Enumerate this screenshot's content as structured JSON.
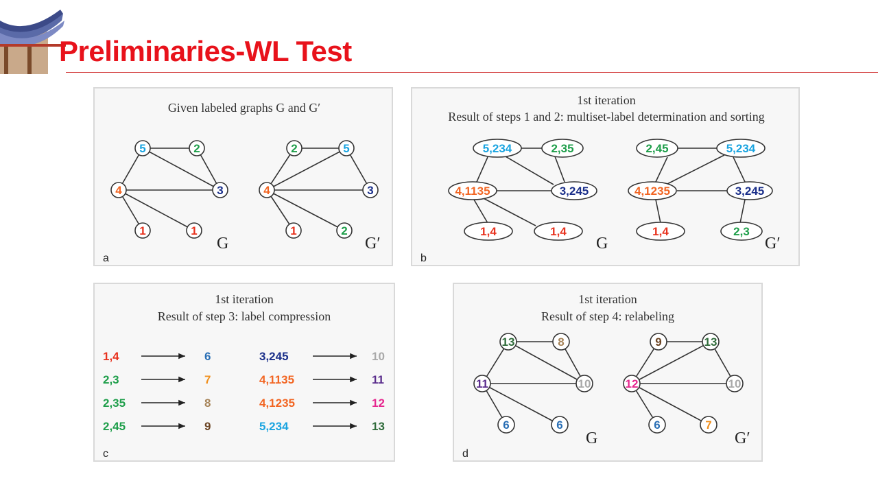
{
  "slide": {
    "title": "Preliminaries-WL Test"
  },
  "colors": {
    "title": "#e8121b",
    "red": "#e8321e",
    "orange": "#f26522",
    "green": "#1e9e4a",
    "cyan": "#1aa4e0",
    "navy": "#1a2f8a",
    "blue": "#2a6fb5",
    "brown": "#8b5a2b",
    "tan": "#a68358",
    "dkgreen": "#2f6b3a",
    "gray": "#a9a9a9",
    "purple": "#5a2d8c",
    "magenta": "#e6288f",
    "amber": "#f0901e"
  },
  "panel_a": {
    "letter": "a",
    "caption": "Given labeled graphs G and G′",
    "G": {
      "name": "G",
      "labels": [
        "5",
        "2",
        "4",
        "3",
        "1",
        "1"
      ]
    },
    "Gp": {
      "name": "G′",
      "labels": [
        "2",
        "5",
        "4",
        "3",
        "1",
        "2"
      ]
    }
  },
  "panel_b": {
    "letter": "b",
    "caption1": "1st iteration",
    "caption2": "Result of steps 1 and 2: multiset-label determination and sorting",
    "G": {
      "name": "G",
      "labels": [
        "5,234",
        "2,35",
        "4,1135",
        "3,245",
        "1,4",
        "1,4"
      ]
    },
    "Gp": {
      "name": "G′",
      "labels": [
        "2,45",
        "5,234",
        "4,1235",
        "3,245",
        "1,4",
        "2,3"
      ]
    }
  },
  "panel_c": {
    "letter": "c",
    "caption1": "1st iteration",
    "caption2": "Result of step 3: label compression",
    "mappings": [
      {
        "from": "1,4",
        "to": "6"
      },
      {
        "from": "2,3",
        "to": "7"
      },
      {
        "from": "2,35",
        "to": "8"
      },
      {
        "from": "2,45",
        "to": "9"
      },
      {
        "from": "3,245",
        "to": "10"
      },
      {
        "from": "4,1135",
        "to": "11"
      },
      {
        "from": "4,1235",
        "to": "12"
      },
      {
        "from": "5,234",
        "to": "13"
      }
    ]
  },
  "panel_d": {
    "letter": "d",
    "caption1": "1st iteration",
    "caption2": "Result of step 4: relabeling",
    "G": {
      "name": "G",
      "labels": [
        "13",
        "8",
        "11",
        "10",
        "6",
        "6"
      ]
    },
    "Gp": {
      "name": "G′",
      "labels": [
        "9",
        "13",
        "12",
        "10",
        "6",
        "7"
      ]
    }
  }
}
